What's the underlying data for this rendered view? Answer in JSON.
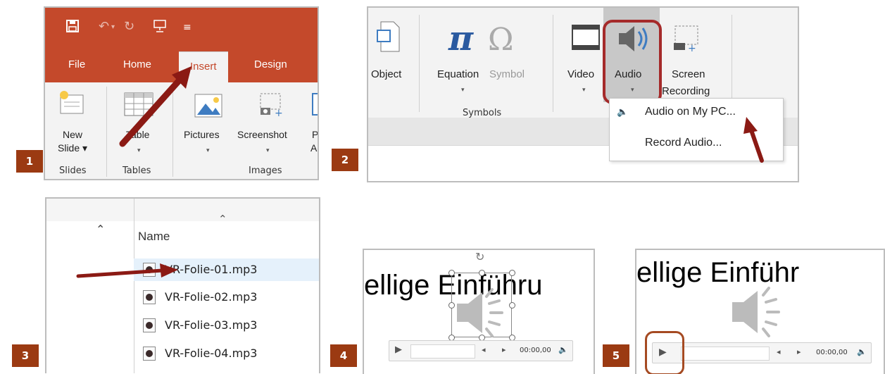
{
  "steps": [
    "1",
    "2",
    "3",
    "4",
    "5"
  ],
  "colors": {
    "accent": "#c4492b",
    "badge": "#9b3a12",
    "arrow": "#8b1a14",
    "highlight": "#a52a2a"
  },
  "panel1": {
    "qat_icons": [
      "save-icon",
      "undo-icon",
      "redo-icon",
      "present-icon",
      "customize-icon"
    ],
    "tabs": [
      "File",
      "Home",
      "Insert",
      "Design"
    ],
    "new_slide": {
      "line1": "New",
      "line2": "Slide ▾"
    },
    "table": "Table",
    "pictures": "Pictures",
    "screenshot": "Screenshot",
    "photo_album_cut": "P",
    "photo_album_cut2": "Al",
    "groups": [
      "Slides",
      "Tables",
      "Images"
    ]
  },
  "panel2": {
    "buttons": {
      "object": "Object",
      "equation": "Equation",
      "symbol": "Symbol",
      "video": "Video",
      "audio": "Audio",
      "screen1": "Screen",
      "screen2": "Recording"
    },
    "group_symbols": "Symbols",
    "menu": [
      "Audio on My PC...",
      "Record Audio..."
    ]
  },
  "panel3": {
    "column": "Name",
    "files": [
      "VR-Folie-01.mp3",
      "VR-Folie-02.mp3",
      "VR-Folie-03.mp3",
      "VR-Folie-04.mp3"
    ]
  },
  "panel4": {
    "title": "ellige Einführu",
    "time": "00:00,00"
  },
  "panel5": {
    "title": "ellige Einführ",
    "time": "00:00,00"
  }
}
